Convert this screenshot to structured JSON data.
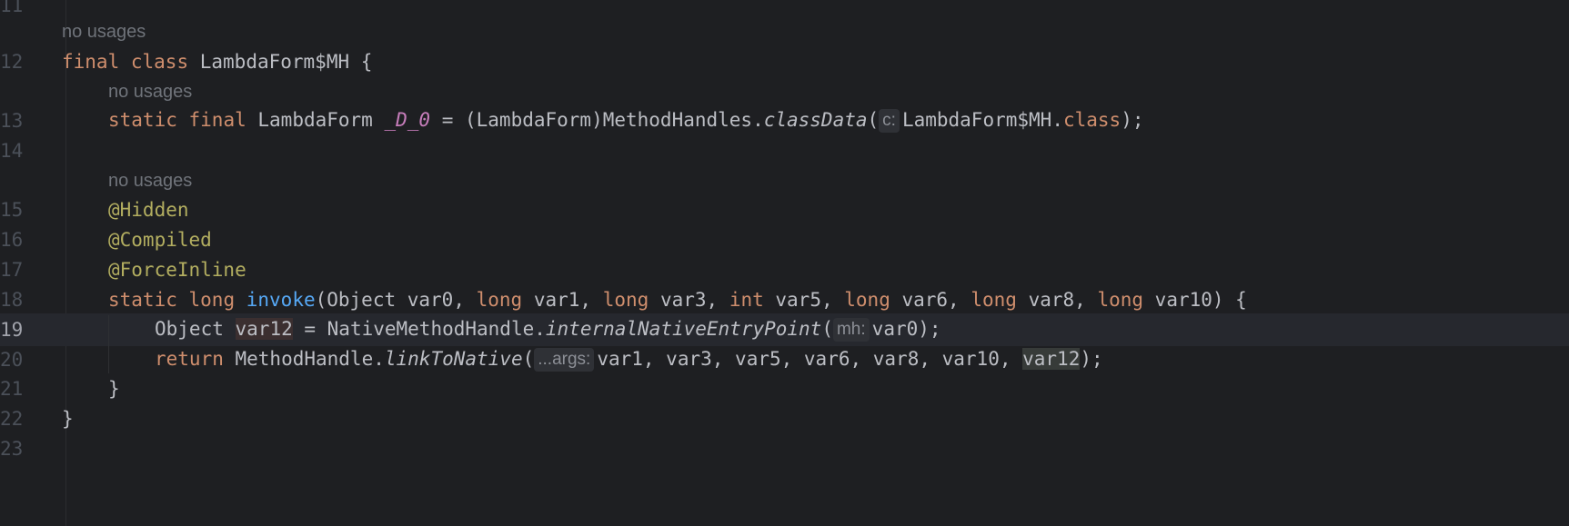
{
  "editor": {
    "line_numbers": [
      "11",
      "12",
      "13",
      "14",
      "15",
      "16",
      "17",
      "18",
      "19",
      "20",
      "21",
      "22",
      "23"
    ],
    "usage_hint": "no usages",
    "class_decl": {
      "kw1": "final",
      "kw2": "class",
      "name": "LambdaForm$MH",
      "brace": "{"
    },
    "field_decl": {
      "kw1": "static",
      "kw2": "final",
      "type": "LambdaForm",
      "name": "_D_0",
      "rhs_prefix": " = (LambdaForm)MethodHandles.",
      "method": "classData",
      "open": "(",
      "hint": "c:",
      "arg": "LambdaForm$MH.",
      "arg_kw": "class",
      "close": ");"
    },
    "annotations": [
      "@Hidden",
      "@Compiled",
      "@ForceInline"
    ],
    "method_decl": {
      "kw1": "static",
      "kw2": "long",
      "name": "invoke",
      "p0": "(Object var0, ",
      "t1": "long",
      "p1": " var1, ",
      "t2": "long",
      "p2": " var3, ",
      "t3": "int",
      "p3": " var5, ",
      "t4": "long",
      "p4": " var6, ",
      "t5": "long",
      "p5": " var8, ",
      "t6": "long",
      "p6": " var10) {"
    },
    "stmt1": {
      "type": "Object ",
      "var": "var12",
      "rhs": " = NativeMethodHandle.",
      "method": "internalNativeEntryPoint",
      "open": "(",
      "hint": "mh:",
      "arg": "var0);"
    },
    "stmt2": {
      "kw": "return",
      "rhs": " MethodHandle.",
      "method": "linkToNative",
      "open": "(",
      "hint": "...args:",
      "args": "var1, var3, var5, var6, var8, var10, ",
      "last": "var12",
      "close": ");"
    },
    "close_method": "}",
    "close_class": "}"
  }
}
